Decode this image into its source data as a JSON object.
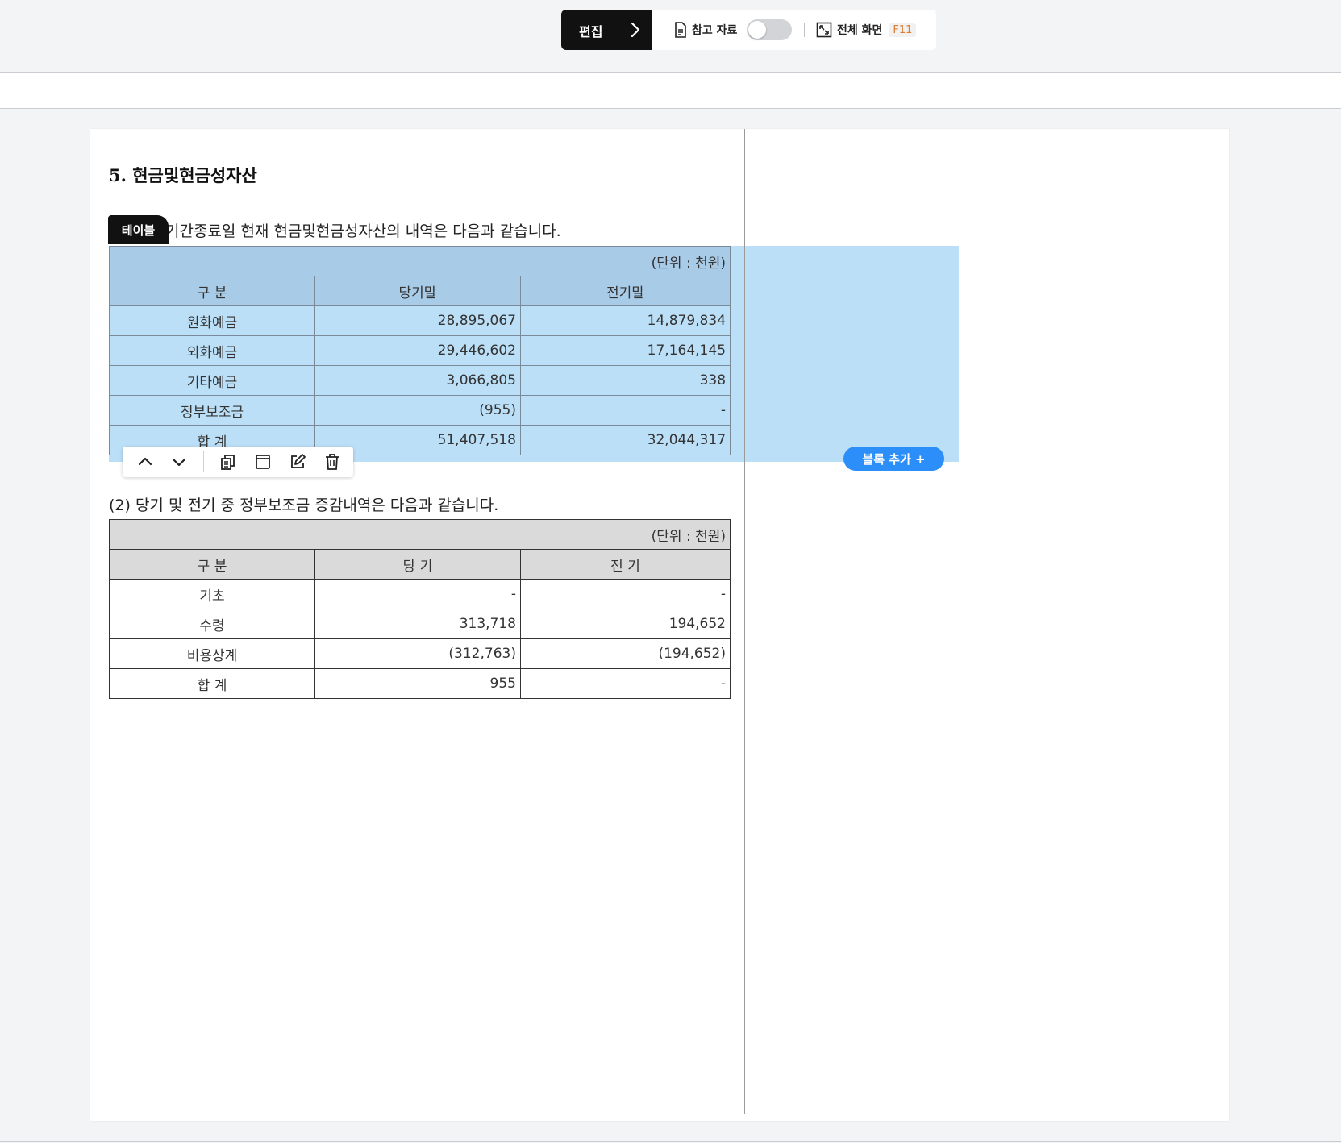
{
  "toolbar": {
    "edit_label": "편집",
    "reference_label": "참고 자료",
    "reference_toggle_on": false,
    "fullscreen_label": "전체 화면",
    "fullscreen_key": "F11"
  },
  "document": {
    "section_title": "5. 현금및현금성자산",
    "intro_text": "기간종료일 현재 현금및현금성자산의 내역은 다음과 같습니다.",
    "selected_block_tag": "테이블",
    "table1": {
      "unit": "(단위 : 천원)",
      "headers": [
        "구 분",
        "당기말",
        "전기말"
      ],
      "rows": [
        [
          "원화예금",
          "28,895,067",
          "14,879,834"
        ],
        [
          "외화예금",
          "29,446,602",
          "17,164,145"
        ],
        [
          "기타예금",
          "3,066,805",
          "338"
        ],
        [
          "정부보조금",
          "(955)",
          "-"
        ],
        [
          "합 계",
          "51,407,518",
          "32,044,317"
        ]
      ]
    },
    "para2": "(2) 당기 및 전기 중 정부보조금 증감내역은 다음과 같습니다.",
    "table2": {
      "unit": "(단위 : 천원)",
      "headers": [
        "구 분",
        "당 기",
        "전 기"
      ],
      "rows": [
        [
          "기초",
          "-",
          "-"
        ],
        [
          "수령",
          "313,718",
          "194,652"
        ],
        [
          "비용상계",
          "(312,763)",
          "(194,652)"
        ],
        [
          "합 계",
          "955",
          "-"
        ]
      ]
    }
  },
  "block_toolbar": {
    "icons": [
      "move-up-icon",
      "move-down-icon",
      "copy-icon",
      "window-icon",
      "edit-icon",
      "delete-icon"
    ]
  },
  "add_block_label": "블록 추가 +",
  "colors": {
    "selection": "#bcdff8",
    "selection_header": "#a8cbe8",
    "accent_button": "#2c8ef8",
    "dark": "#111111",
    "shortcut_key": "#e07b2d"
  }
}
